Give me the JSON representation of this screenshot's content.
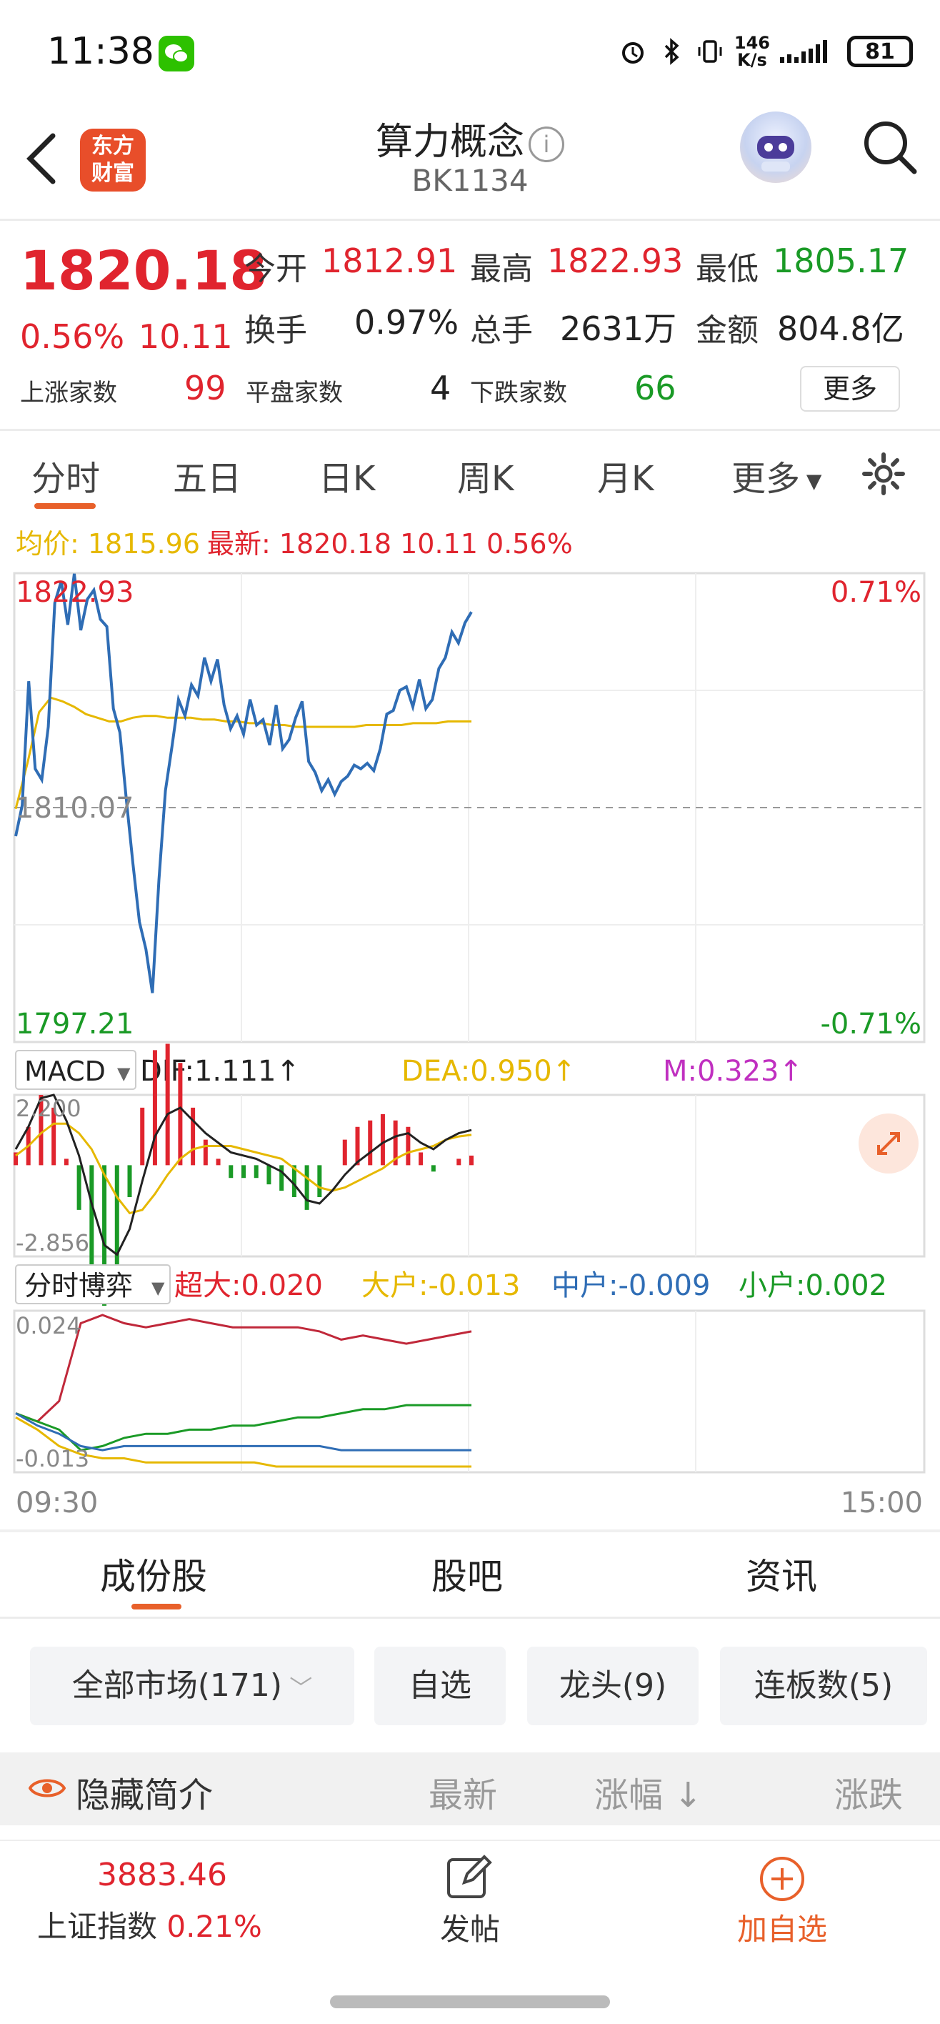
{
  "status_bar": {
    "time": "11:38",
    "net_speed_top": "146",
    "net_speed_unit": "K/s",
    "battery": "81"
  },
  "header": {
    "logo_line1": "东方",
    "logo_line2": "财富",
    "title": "算力概念",
    "code": "BK1134"
  },
  "quote": {
    "price": "1820.18",
    "change_pct": "0.56%",
    "change": "10.11",
    "open_label": "今开",
    "open": "1812.91",
    "high_label": "最高",
    "high": "1822.93",
    "low_label": "最低",
    "low": "1805.17",
    "turnover_label": "换手",
    "turnover": "0.97%",
    "volume_label": "总手",
    "volume": "2631万",
    "amount_label": "金额",
    "amount": "804.8亿",
    "up_label": "上涨家数",
    "up": "99",
    "flat_label": "平盘家数",
    "flat": "4",
    "down_label": "下跌家数",
    "down": "66",
    "more": "更多"
  },
  "chart_tabs": [
    "分时",
    "五日",
    "日K",
    "周K",
    "月K",
    "更多"
  ],
  "price_line": {
    "avg_label": "均价: 1815.96",
    "latest_label": "最新: 1820.18 10.11 0.56%"
  },
  "chart_labels": {
    "max_price": "1822.93",
    "pre_close": "1810.07",
    "min_price": "1797.21",
    "max_pct": "0.71%",
    "min_pct": "-0.71%",
    "macd_select": "MACD",
    "dif": "DIF:1.111↑",
    "dea": "DEA:0.950↑",
    "m": "M:0.323↑",
    "macd_max": "2.200",
    "macd_min": "-2.856",
    "flow_select": "分时博弈",
    "super": "超大:0.020",
    "big": "大户:-0.013",
    "mid": "中户:-0.009",
    "small": "小户:0.002",
    "flow_max": "0.024",
    "flow_min": "-0.013",
    "time_start": "09:30",
    "time_end": "15:00"
  },
  "chart_data": {
    "type": "line",
    "price_axis": {
      "max": 1822.93,
      "pre_close": 1810.07,
      "min": 1797.21
    },
    "price_series": [
      1808.5,
      1810.2,
      1817.0,
      1812.2,
      1811.6,
      1814.5,
      1821.3,
      1822.5,
      1820.1,
      1822.9,
      1819.8,
      1821.5,
      1822.0,
      1820.4,
      1820.0,
      1815.5,
      1814.2,
      1810.5,
      1807.0,
      1803.8,
      1802.3,
      1799.9,
      1806.1,
      1811.0,
      1813.4,
      1816.0,
      1815.1,
      1816.8,
      1816.2,
      1818.3,
      1817.0,
      1818.2,
      1815.7,
      1814.4,
      1815.1,
      1814.1,
      1816.0,
      1814.6,
      1814.9,
      1813.5,
      1815.7,
      1813.3,
      1813.8,
      1815.0,
      1815.9,
      1812.6,
      1812.0,
      1811.0,
      1811.6,
      1810.8,
      1811.5,
      1811.8,
      1812.4,
      1812.2,
      1812.5,
      1812.1,
      1813.3,
      1815.2,
      1815.4,
      1816.5,
      1816.7,
      1815.6,
      1817.1,
      1815.5,
      1816.0,
      1817.7,
      1818.3,
      1819.7,
      1819.1,
      1820.2,
      1820.8
    ],
    "avg_series": [
      1810.0,
      1812.5,
      1815.3,
      1816.1,
      1815.9,
      1815.6,
      1815.2,
      1815.0,
      1814.8,
      1814.8,
      1815.0,
      1815.1,
      1815.1,
      1815.0,
      1815.0,
      1815.0,
      1814.9,
      1814.9,
      1814.8,
      1814.8,
      1814.7,
      1814.7,
      1814.6,
      1814.6,
      1814.5,
      1814.5,
      1814.5,
      1814.5,
      1814.5,
      1814.5,
      1814.6,
      1814.6,
      1814.6,
      1814.6,
      1814.7,
      1814.7,
      1814.7,
      1814.8,
      1814.8,
      1814.8
    ],
    "macd_dif": [
      0.5,
      1.2,
      2.1,
      2.2,
      1.4,
      0.3,
      -1.2,
      -2.5,
      -2.8,
      -2.0,
      -0.5,
      0.9,
      1.6,
      1.8,
      1.4,
      1.0,
      0.7,
      0.4,
      0.3,
      0.2,
      0.0,
      -0.2,
      -0.6,
      -1.1,
      -1.2,
      -0.8,
      -0.3,
      0.1,
      0.4,
      0.7,
      0.9,
      1.0,
      0.7,
      0.5,
      0.8,
      1.0,
      1.1
    ],
    "macd_dea": [
      0.3,
      0.6,
      1.0,
      1.3,
      1.3,
      1.0,
      0.5,
      -0.3,
      -1.0,
      -1.5,
      -1.4,
      -0.9,
      -0.3,
      0.2,
      0.5,
      0.6,
      0.6,
      0.6,
      0.5,
      0.4,
      0.3,
      0.2,
      -0.1,
      -0.4,
      -0.7,
      -0.8,
      -0.7,
      -0.5,
      -0.3,
      -0.1,
      0.2,
      0.4,
      0.5,
      0.6,
      0.8,
      0.9,
      0.95
    ],
    "flow_super": [
      0.0,
      -0.002,
      0.003,
      0.022,
      0.024,
      0.022,
      0.021,
      0.022,
      0.023,
      0.022,
      0.021,
      0.021,
      0.021,
      0.021,
      0.02,
      0.018,
      0.019,
      0.018,
      0.017,
      0.018,
      0.019,
      0.02
    ],
    "flow_big": [
      -0.001,
      -0.004,
      -0.008,
      -0.01,
      -0.011,
      -0.011,
      -0.012,
      -0.012,
      -0.012,
      -0.012,
      -0.012,
      -0.012,
      -0.013,
      -0.013,
      -0.013,
      -0.013,
      -0.013,
      -0.013,
      -0.013,
      -0.013,
      -0.013,
      -0.013
    ],
    "flow_mid": [
      0.0,
      -0.003,
      -0.005,
      -0.008,
      -0.009,
      -0.008,
      -0.008,
      -0.008,
      -0.008,
      -0.008,
      -0.008,
      -0.008,
      -0.008,
      -0.008,
      -0.008,
      -0.009,
      -0.009,
      -0.009,
      -0.009,
      -0.009,
      -0.009,
      -0.009
    ],
    "flow_small": [
      0.0,
      -0.002,
      -0.004,
      -0.009,
      -0.008,
      -0.006,
      -0.005,
      -0.005,
      -0.004,
      -0.004,
      -0.003,
      -0.003,
      -0.002,
      -0.001,
      -0.001,
      0.0,
      0.001,
      0.001,
      0.002,
      0.002,
      0.002,
      0.002
    ]
  },
  "bottom_tabs": [
    "成份股",
    "股吧",
    "资讯"
  ],
  "filters": [
    "全部市场(171)",
    "自选",
    "龙头(9)",
    "连板数(5)"
  ],
  "list_header": {
    "hide": "隐藏简介",
    "latest": "最新",
    "rise": "涨幅",
    "change": "涨跌"
  },
  "footer": {
    "index_value": "3883.46",
    "index_name": "上证指数",
    "index_pct": "0.21%",
    "post": "发帖",
    "add": "加自选"
  },
  "colors": {
    "red": "#e0242e",
    "green": "#1a9a26",
    "orange": "#e8602a",
    "price_line": "#2f6db5",
    "avg_line": "#e6b800"
  }
}
